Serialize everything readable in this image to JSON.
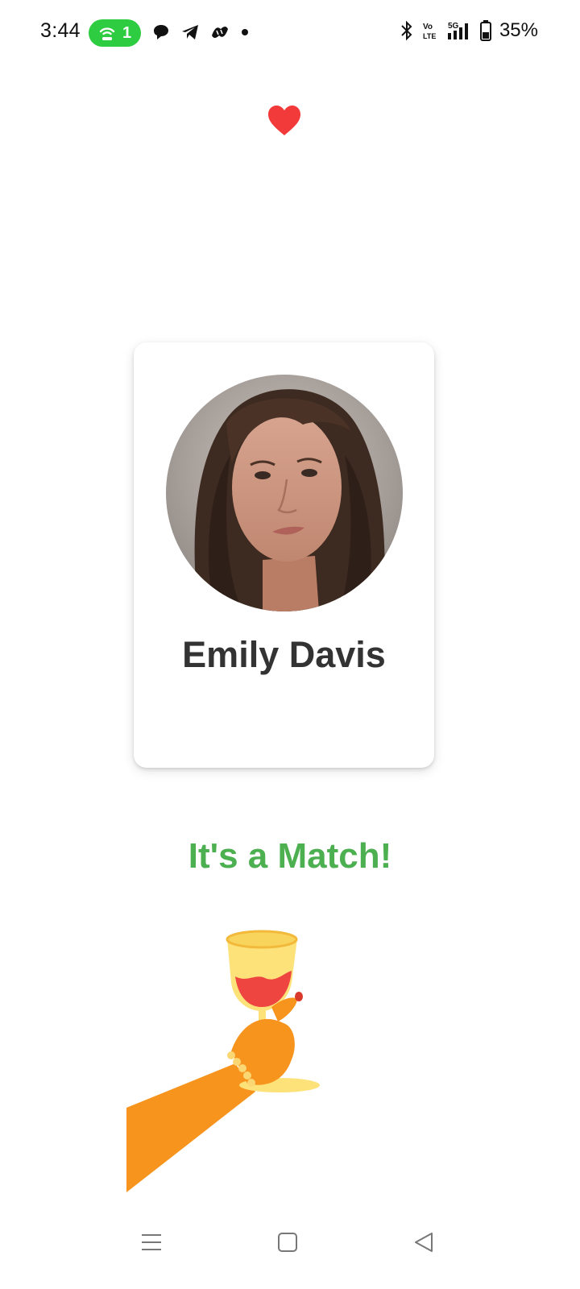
{
  "status_bar": {
    "time": "3:44",
    "hotspot_count": "1",
    "battery": "35%",
    "network": "5G",
    "icons": [
      "hotspot-icon",
      "chat-icon",
      "telegram-icon",
      "app-icon",
      "dot-icon",
      "bluetooth-icon",
      "volte-icon",
      "signal-icon",
      "battery-icon"
    ]
  },
  "heart_icon": "heart-icon",
  "profile": {
    "name": "Emily Davis"
  },
  "match": {
    "title": "It's a Match!"
  },
  "nav_bar": {
    "icons": [
      "menu-icon",
      "home-icon",
      "back-icon"
    ]
  },
  "colors": {
    "accent_green": "#4caf50",
    "heart_red": "#f23a3a",
    "pill_green": "#2ecc40"
  }
}
